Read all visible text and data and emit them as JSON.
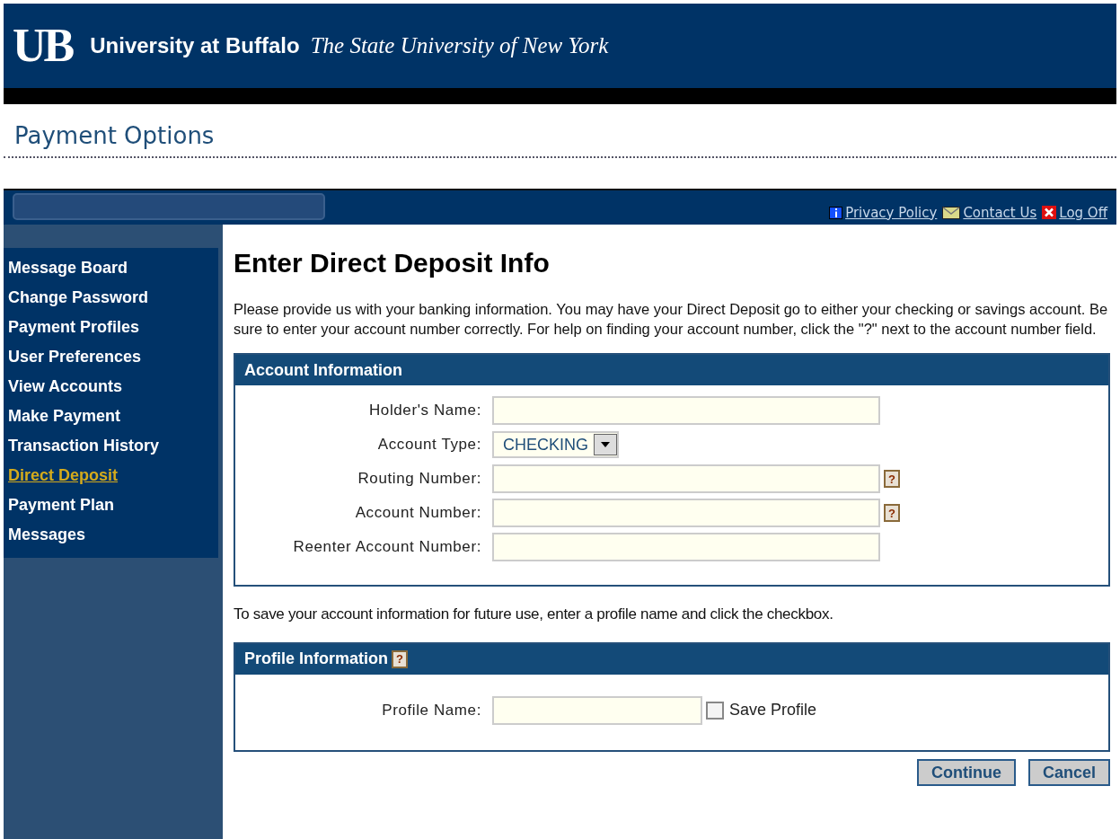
{
  "header": {
    "logo": "UB",
    "name": "University at Buffalo",
    "tagline": "The State University of New York"
  },
  "page_title": "Payment Options",
  "top_links": [
    {
      "label": "Privacy Policy"
    },
    {
      "label": "Contact Us"
    },
    {
      "label": "Log Off"
    }
  ],
  "sidebar": {
    "items": [
      {
        "label": "Message Board",
        "selected": false
      },
      {
        "label": "Change Password",
        "selected": false
      },
      {
        "label": "Payment Profiles",
        "selected": false
      },
      {
        "label": "User Preferences",
        "selected": false
      },
      {
        "label": "View Accounts",
        "selected": false
      },
      {
        "label": "Make Payment",
        "selected": false
      },
      {
        "label": "Transaction History",
        "selected": false
      },
      {
        "label": "Direct Deposit",
        "selected": true
      },
      {
        "label": "Payment Plan",
        "selected": false
      },
      {
        "label": "Messages",
        "selected": false
      }
    ]
  },
  "heading": "Enter Direct Deposit Info",
  "intro": "Please provide us with your banking information. You may have your Direct Deposit go to either your checking or savings account. Be sure to enter your account number correctly. For help on finding your account number, click the \"?\" next to the account number field.",
  "account_section": {
    "title": "Account Information",
    "fields": [
      {
        "label": "Holder's Name:",
        "kind": "text"
      },
      {
        "label": "Account Type:",
        "kind": "select",
        "value": "CHECKING"
      },
      {
        "label": "Routing Number:",
        "kind": "text",
        "help": "?"
      },
      {
        "label": "Account Number:",
        "kind": "text",
        "help": "?"
      },
      {
        "label": "Reenter Account Number:",
        "kind": "text"
      }
    ]
  },
  "save_note": "To save your account information for future use, enter a profile name and click the checkbox.",
  "profile_section": {
    "title": "Profile Information",
    "help": "?",
    "field_label": "Profile Name:",
    "checkbox": {
      "label": "Save Profile",
      "checked": false
    }
  },
  "buttons": [
    "Continue",
    "Cancel"
  ]
}
